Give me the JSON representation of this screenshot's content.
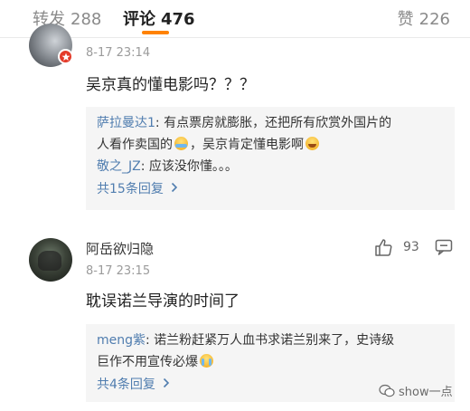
{
  "tabs": {
    "repost": {
      "label": "转发",
      "count": "288"
    },
    "comment": {
      "label": "评论",
      "count": "476"
    },
    "like": {
      "label": "赞",
      "count": "226"
    }
  },
  "comments": [
    {
      "time": "8-17 23:14",
      "content": "吴京真的懂电影吗？？？",
      "replies": [
        {
          "name": "萨拉曼达1",
          "text_part1": ": 有点票房就膨胀，还把所有欣赏外国片的",
          "text_part2": "人看作卖国的",
          "text_part3": "，吴京肯定懂电影啊",
          "emojis": [
            "tears-emoji",
            "laugh-emoji"
          ]
        },
        {
          "name": "敬之_JZ",
          "text": ": 应该没你懂。。。"
        }
      ],
      "more_label": "共15条回复"
    },
    {
      "username": "阿岳欲归隐",
      "time": "8-17 23:15",
      "content": "耽误诺兰导演的时间了",
      "like_count": "93",
      "replies": [
        {
          "name": "meng紫",
          "text_part1": ": 诺兰粉赶紧万人血书求诺兰别来了，史诗级",
          "text_part2": "巨作不用宣传必爆",
          "emojis": [
            "crying-emoji"
          ]
        }
      ],
      "more_label": "共4条回复"
    }
  ],
  "watermark": "show一点",
  "colors": {
    "accent": "#ff8200",
    "link": "#507daf",
    "reply_bg": "#f5f5f5"
  }
}
